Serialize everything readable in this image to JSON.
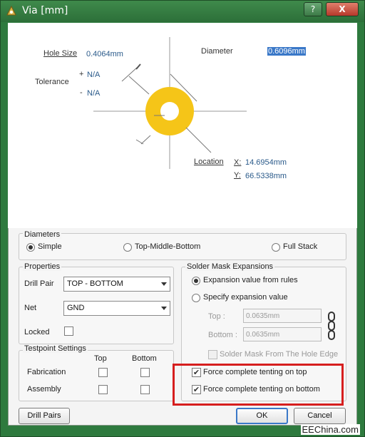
{
  "window": {
    "title": "Via [mm]",
    "help_label": "?",
    "close_label": "X"
  },
  "diagram": {
    "hole_size_label": "Hole Size",
    "hole_size_value": "0.4064mm",
    "tolerance_label": "Tolerance",
    "tol_plus_sign": "+",
    "tol_plus_value": "N/A",
    "tol_minus_sign": "-",
    "tol_minus_value": "N/A",
    "diameter_label": "Diameter",
    "diameter_value": "0.6096mm",
    "location_label": "Location",
    "x_label": "X:",
    "x_value": "14.6954mm",
    "y_label": "Y:",
    "y_value": "66.5338mm",
    "pad_color": "#f5c518"
  },
  "diameters": {
    "title": "Diameters",
    "options": [
      "Simple",
      "Top-Middle-Bottom",
      "Full Stack"
    ],
    "selected": "Simple"
  },
  "properties": {
    "title": "Properties",
    "drill_pair_label": "Drill Pair",
    "drill_pair_value": "TOP - BOTTOM",
    "net_label": "Net",
    "net_value": "GND",
    "locked_label": "Locked",
    "locked": false
  },
  "testpoint": {
    "title": "Testpoint Settings",
    "col_top": "Top",
    "col_bottom": "Bottom",
    "row_fabrication": "Fabrication",
    "row_assembly": "Assembly"
  },
  "solder_mask": {
    "title": "Solder Mask Expansions",
    "opt_rules": "Expansion value from rules",
    "opt_specify": "Specify expansion value",
    "top_label": "Top :",
    "top_value": "0.0635mm",
    "bottom_label": "Bottom :",
    "bottom_value": "0.0635mm",
    "from_hole_edge": "Solder Mask From The Hole Edge",
    "tent_top": "Force complete tenting on top",
    "tent_bottom": "Force complete tenting on bottom"
  },
  "buttons": {
    "drill_pairs": "Drill Pairs",
    "ok": "OK",
    "cancel": "Cancel"
  },
  "watermark": "EEChina.com",
  "colors": {
    "highlight_box": "#d61e1e",
    "title_bar": "#2e7a3e"
  }
}
